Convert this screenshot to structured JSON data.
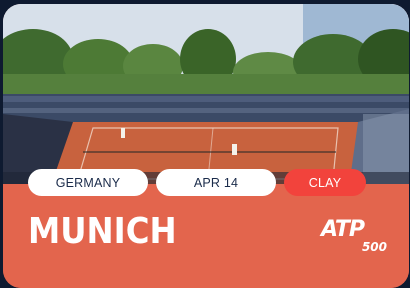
{
  "card": {
    "tags": {
      "country": "GERMANY",
      "date": "APR 14",
      "surface": "CLAY"
    },
    "city": "MUNICH",
    "logo": {
      "brand": "ATP",
      "tier": "500"
    },
    "colors": {
      "card_background": "#e3654d",
      "surface_pill": "#f2433c",
      "pill_text": "#1a2b4a",
      "clay_court": "#c8623e"
    }
  }
}
